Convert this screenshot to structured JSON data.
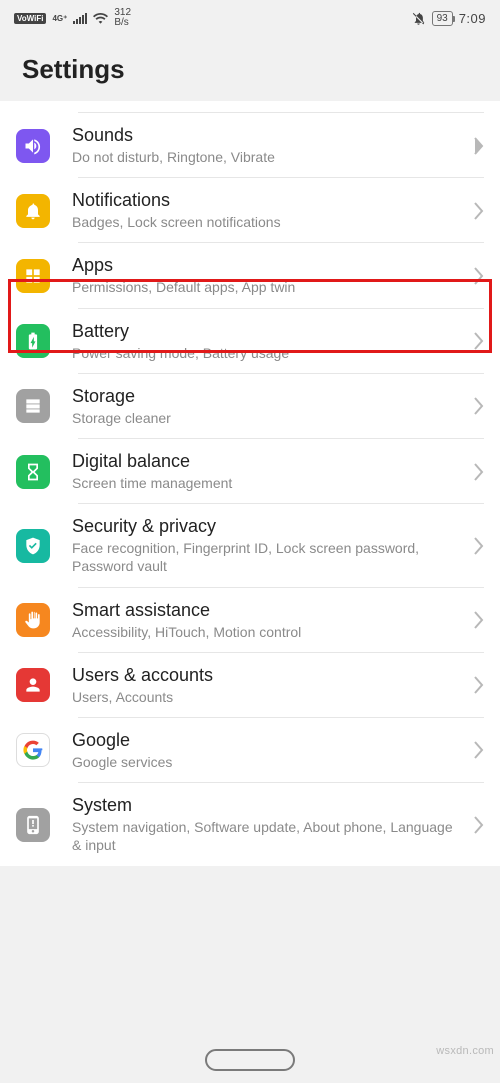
{
  "status": {
    "vowifi": "VoWiFi",
    "signal_label": "4G⁺",
    "net_speed_top": "312",
    "net_speed_bottom": "B/s",
    "battery_pct": "93",
    "time": "7:09"
  },
  "header": {
    "title": "Settings"
  },
  "items": [
    {
      "title": "Sounds",
      "sub": "Do not disturb, Ringtone, Vibrate"
    },
    {
      "title": "Notifications",
      "sub": "Badges, Lock screen notifications"
    },
    {
      "title": "Apps",
      "sub": "Permissions, Default apps, App twin"
    },
    {
      "title": "Battery",
      "sub": "Power saving mode, Battery usage"
    },
    {
      "title": "Storage",
      "sub": "Storage cleaner"
    },
    {
      "title": "Digital balance",
      "sub": "Screen time management"
    },
    {
      "title": "Security & privacy",
      "sub": "Face recognition, Fingerprint ID, Lock screen password, Password vault"
    },
    {
      "title": "Smart assistance",
      "sub": "Accessibility, HiTouch, Motion control"
    },
    {
      "title": "Users & accounts",
      "sub": "Users, Accounts"
    },
    {
      "title": "Google",
      "sub": "Google services"
    },
    {
      "title": "System",
      "sub": "System navigation, Software update, About phone, Language & input"
    }
  ],
  "watermark": "wsxdn.com"
}
